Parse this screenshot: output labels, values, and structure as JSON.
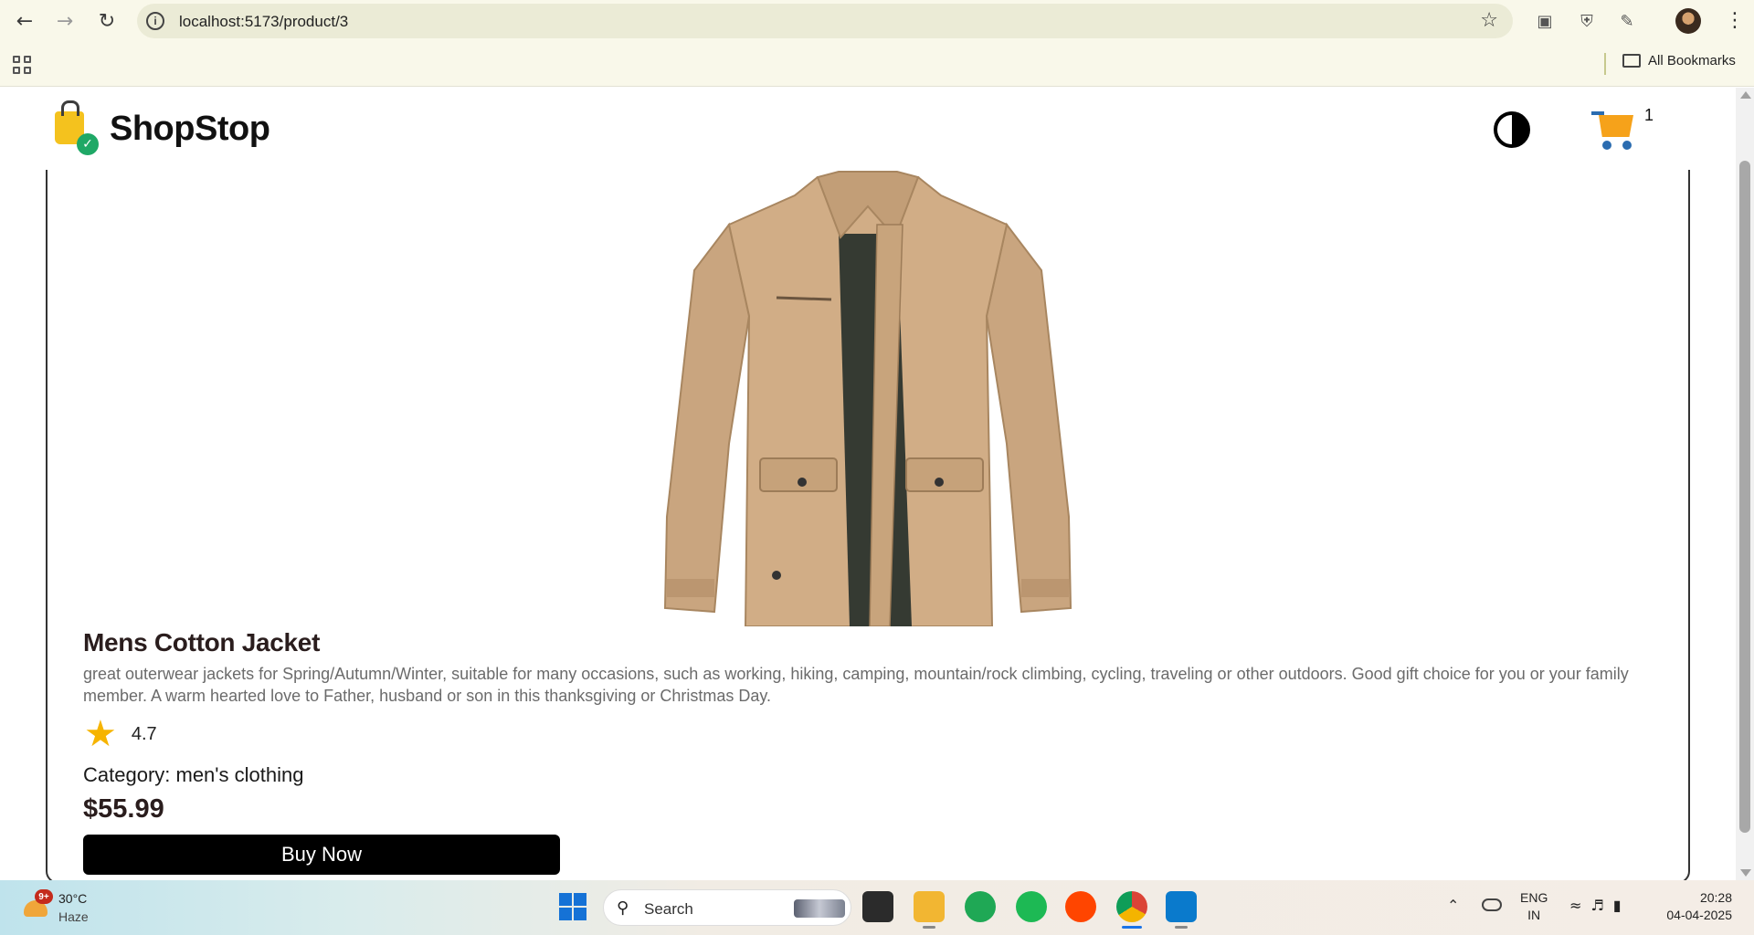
{
  "browser": {
    "url": "localhost:5173/product/3",
    "bookmarks_label": "All Bookmarks"
  },
  "app": {
    "brand": "ShopStop",
    "cart_count": "1"
  },
  "product": {
    "title": "Mens Cotton Jacket",
    "description": "great outerwear jackets for Spring/Autumn/Winter, suitable for many occasions, such as working, hiking, camping, mountain/rock climbing, cycling, traveling or other outdoors. Good gift choice for you or your family member. A warm hearted love to Father, husband or son in this thanksgiving or Christmas Day.",
    "rating": "4.7",
    "category_label": "Category: men's clothing",
    "price": "$55.99",
    "buy_label": "Buy Now",
    "image_icon": "tan-jacket-image"
  },
  "taskbar": {
    "weather_badge": "9+",
    "temperature": "30°C",
    "condition": "Haze",
    "search_label": "Search",
    "lang_line1": "ENG",
    "lang_line2": "IN",
    "time": "20:28",
    "date": "04-04-2025"
  },
  "colors": {
    "accent_star": "#f6b400",
    "buy_bg": "#000000",
    "chrome_bg": "#f9f8ea"
  }
}
